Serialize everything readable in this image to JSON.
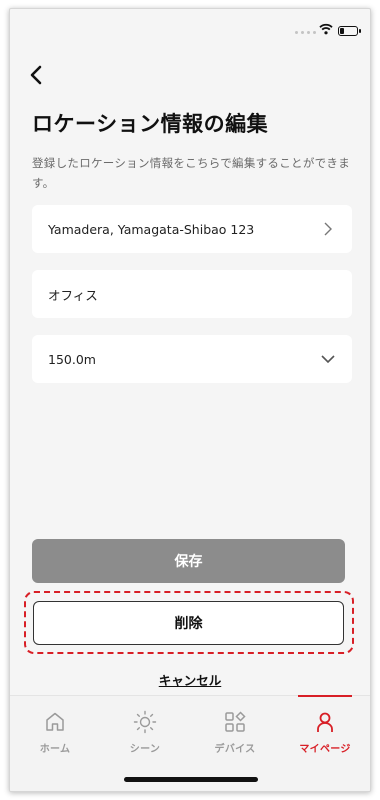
{
  "header": {
    "title": "ロケーション情報の編集",
    "description": "登録したロケーション情報をこちらで編集することができます。"
  },
  "fields": {
    "address": "Yamadera, Yamagata-Shibao 123",
    "name": "オフィス",
    "radius": "150.0m"
  },
  "buttons": {
    "save": "保存",
    "delete": "削除",
    "cancel": "キャンセル"
  },
  "tabs": [
    {
      "label": "ホーム",
      "icon": "home-icon",
      "active": false
    },
    {
      "label": "シーン",
      "icon": "sun-icon",
      "active": false
    },
    {
      "label": "デバイス",
      "icon": "devices-icon",
      "active": false
    },
    {
      "label": "マイページ",
      "icon": "person-icon",
      "active": true
    }
  ],
  "colors": {
    "accent": "#d81f26",
    "save_button": "#8c8c8c",
    "background": "#f5f5f5"
  }
}
